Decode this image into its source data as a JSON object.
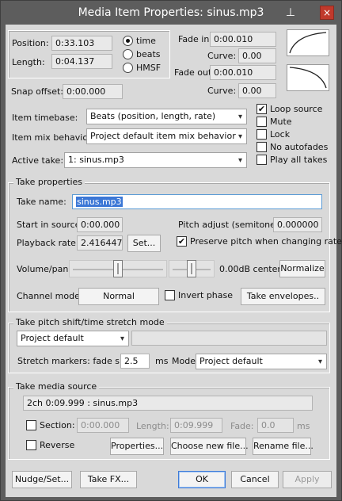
{
  "window": {
    "title": "Media Item Properties:  sinus.mp3",
    "pin_icon": "pin-icon",
    "close_icon": "close-icon",
    "close_glyph": "×",
    "pin_glyph": "⊥"
  },
  "position_box": {
    "position_label": "Position:",
    "position_value": "0:33.103",
    "length_label": "Length:",
    "length_value": "0:04.137",
    "time_modes": [
      {
        "label": "time",
        "selected": true
      },
      {
        "label": "beats",
        "selected": false
      },
      {
        "label": "HMSF",
        "selected": false
      }
    ]
  },
  "fades": {
    "fade_in_label": "Fade in:",
    "fade_in_value": "0:00.010",
    "fade_in_curve_label": "Curve:",
    "fade_in_curve_value": "0.00",
    "fade_out_label": "Fade out:",
    "fade_out_value": "0:00.010",
    "fade_out_curve_label": "Curve:",
    "fade_out_curve_value": "0.00"
  },
  "snap": {
    "label": "Snap offset:",
    "value": "0:00.000"
  },
  "timebase": {
    "label": "Item timebase:",
    "value": "Beats (position, length, rate)"
  },
  "mix": {
    "label": "Item mix behavior:",
    "value": "Project default item mix behavior"
  },
  "active_take": {
    "label": "Active take:",
    "value": "1: sinus.mp3"
  },
  "options": [
    {
      "label": "Loop source",
      "checked": true
    },
    {
      "label": "Mute",
      "checked": false
    },
    {
      "label": "Lock",
      "checked": false
    },
    {
      "label": "No autofades",
      "checked": false
    },
    {
      "label": "Play all takes",
      "checked": false
    }
  ],
  "take": {
    "group_title": "Take properties",
    "name_label": "Take name:",
    "name_value": "sinus.mp3",
    "start_label": "Start in source:",
    "start_value": "0:00.000",
    "pitch_label": "Pitch adjust (semitones):",
    "pitch_value": "0.000000",
    "rate_label": "Playback rate:",
    "rate_value": "2.416447",
    "set_button": "Set...",
    "preserve_pitch_label": "Preserve pitch when changing rate",
    "preserve_pitch_checked": true,
    "volpan_label": "Volume/pan:",
    "volume_fraction": 0.5,
    "pan_fraction": 0.5,
    "volpan_readout": "0.00dB  center",
    "normalize_button": "Normalize",
    "channel_label": "Channel mode:",
    "channel_value": "Normal",
    "invert_label": "Invert phase",
    "invert_checked": false,
    "envelopes_button": "Take envelopes.."
  },
  "pitch_shift": {
    "group_title": "Take pitch shift/time stretch mode",
    "mode_value": "Project default",
    "mode_param": "",
    "fade_label": "Stretch markers: fade size:",
    "fade_value": "2.5",
    "fade_unit": "ms",
    "mode_label": "Mode:",
    "marker_mode_value": "Project default"
  },
  "source": {
    "group_title": "Take media source",
    "info": "2ch 0:09.999 : sinus.mp3",
    "section_label": "Section:",
    "section_checked": false,
    "section_value": "0:00.000",
    "length_label": "Length:",
    "length_value": "0:09.999",
    "fade_label": "Fade:",
    "fade_value": "0.0",
    "fade_unit": "ms",
    "reverse_label": "Reverse",
    "reverse_checked": false,
    "properties_button": "Properties...",
    "choose_button": "Choose new file...",
    "rename_button": "Rename file..."
  },
  "footer": {
    "nudge": "Nudge/Set...",
    "take_fx": "Take FX...",
    "ok": "OK",
    "cancel": "Cancel",
    "apply": "Apply"
  },
  "icons": {
    "check_glyph": "✔",
    "arrow_glyph": "▾"
  }
}
